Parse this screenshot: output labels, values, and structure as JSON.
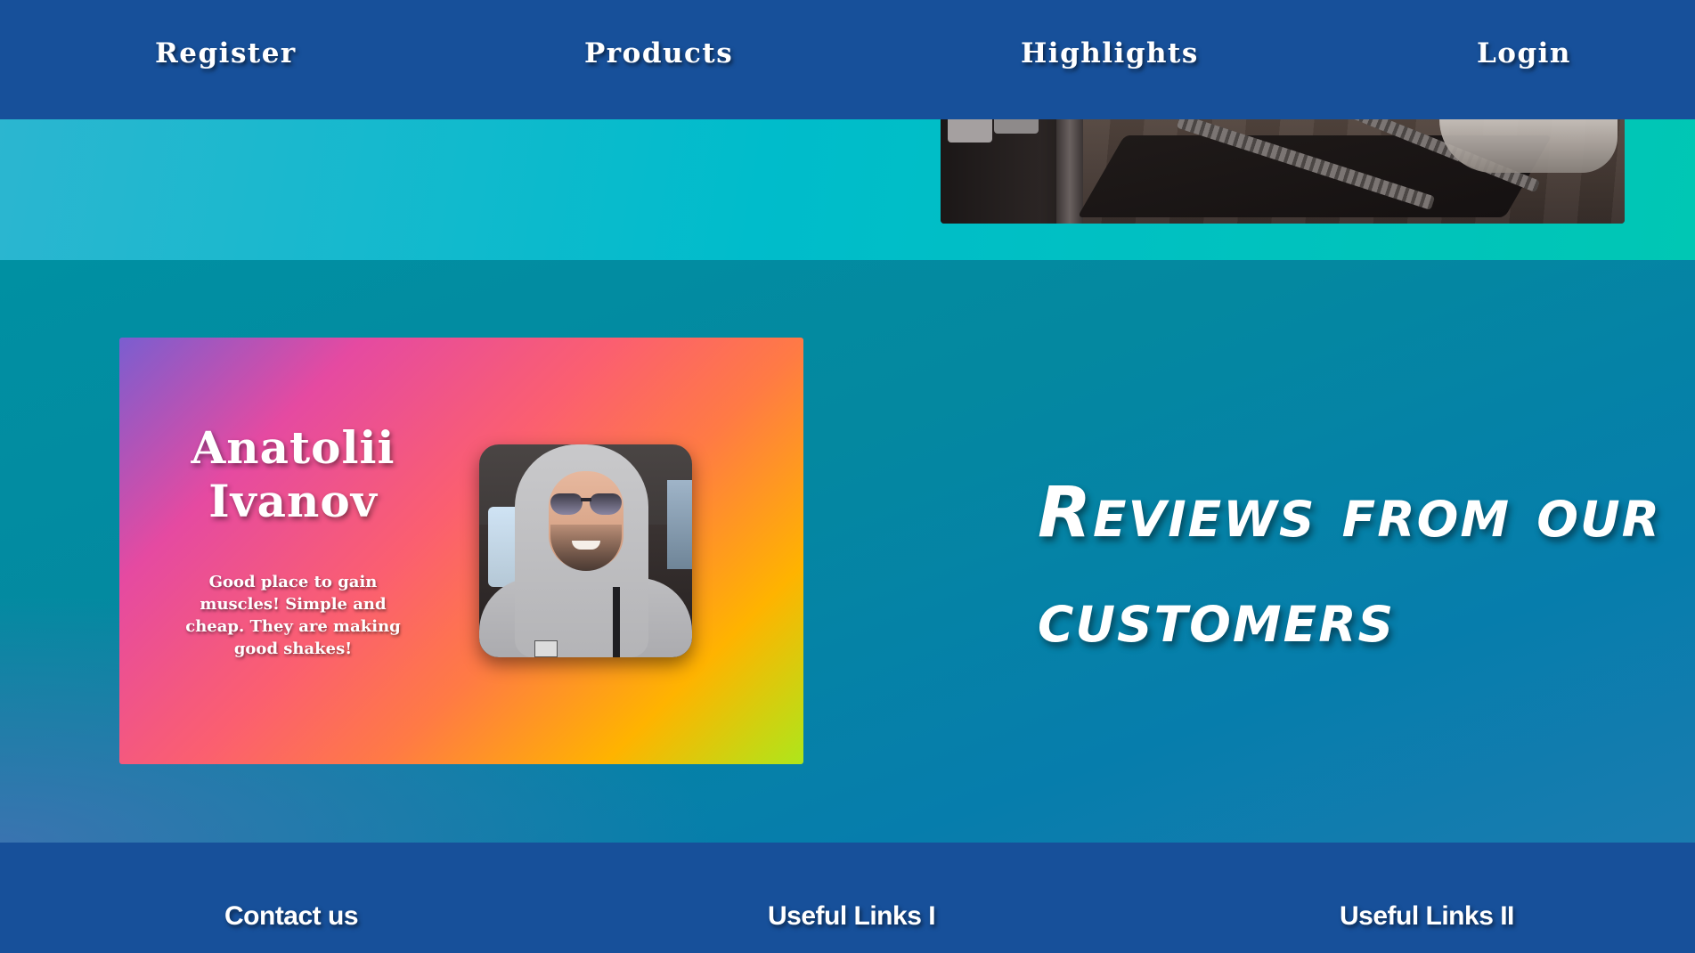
{
  "nav": {
    "items": [
      {
        "label": "Register"
      },
      {
        "label": "Products"
      },
      {
        "label": "Highlights"
      },
      {
        "label": "Login"
      }
    ]
  },
  "hero": {
    "image_icon": "treadmill-photo"
  },
  "reviews": {
    "title": "Reviews from our customers",
    "card": {
      "name": "Anatolii Ivanov",
      "text": "Good place to gain muscles! Simple and cheap. They are making good shakes!",
      "avatar_icon": "reviewer-avatar"
    }
  },
  "footer": {
    "columns": [
      {
        "heading": "Contact us"
      },
      {
        "heading": "Useful Links I"
      },
      {
        "heading": "Useful Links II"
      }
    ]
  },
  "colors": {
    "nav_bg": "#17509a",
    "teal_strip": "#00bccb",
    "section_bg": "#067dac",
    "text": "#ffffff"
  }
}
